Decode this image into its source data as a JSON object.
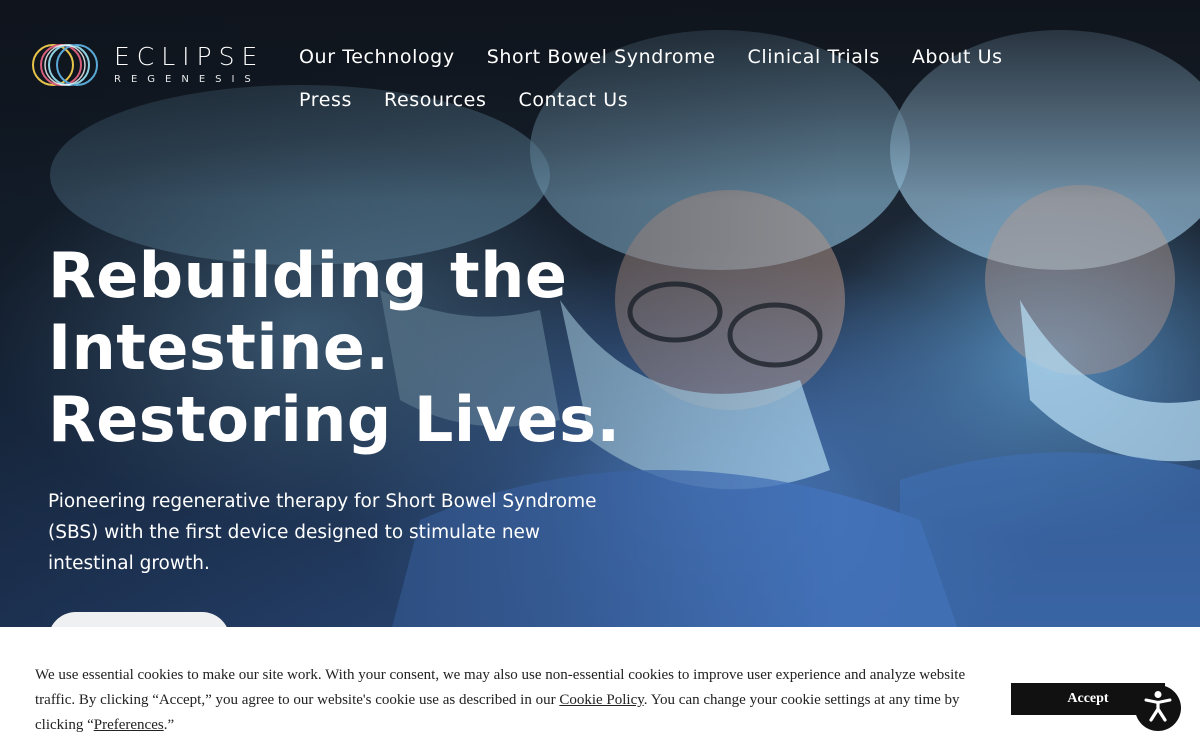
{
  "brand": {
    "name": "ECLIPSE",
    "tagline": "REGENESIS"
  },
  "nav": {
    "items": [
      {
        "label": "Our Technology"
      },
      {
        "label": "Short Bowel Syndrome"
      },
      {
        "label": "Clinical Trials"
      },
      {
        "label": "About Us"
      },
      {
        "label": "Press"
      },
      {
        "label": "Resources"
      },
      {
        "label": "Contact Us"
      }
    ]
  },
  "hero": {
    "headline": [
      "Rebuilding the",
      "Intestine.",
      "Restoring Lives."
    ],
    "subcopy": "Pioneering regenerative therapy for Short Bowel Syndrome (SBS) with the first device designed to stimulate new intestinal growth.",
    "cta_label": ""
  },
  "cookie_banner": {
    "text_1": "We use essential cookies to make our site work. With your consent, we may also use non-essential cookies to improve user experience and analyze website traffic. By clicking “Accept,” you agree to our website's cookie use as described in our ",
    "cookie_policy_link": "Cookie Policy",
    "text_2": ". You can change your cookie settings at any time by clicking “",
    "preferences_link": "Preferences",
    "text_3": ".”",
    "accept_label": "Accept"
  },
  "accessibility": {
    "icon": "accessibility-icon"
  },
  "colors": {
    "banner_bg": "#ffffff",
    "accept_bg": "#111111",
    "hero_blue": "#3a62a6"
  }
}
